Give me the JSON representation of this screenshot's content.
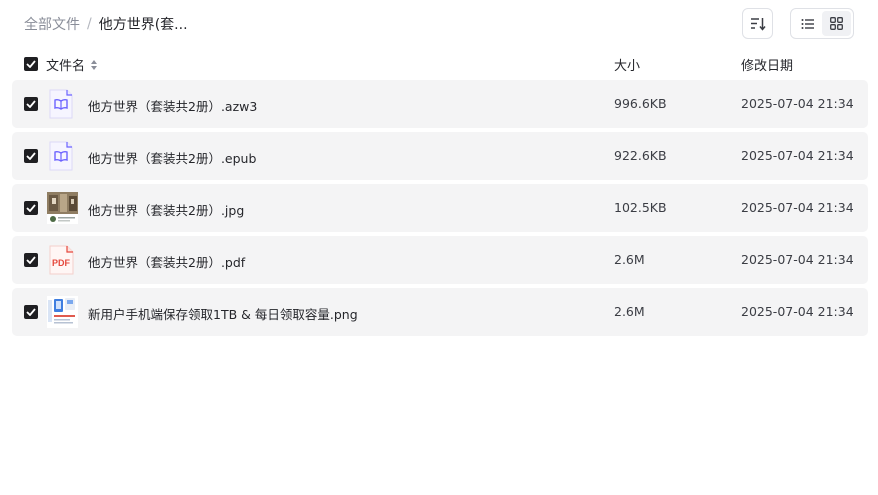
{
  "breadcrumb": {
    "root": "全部文件",
    "separator": "/",
    "current": "他方世界(套..."
  },
  "header": {
    "name": "文件名",
    "size": "大小",
    "modified": "修改日期"
  },
  "files": [
    {
      "name": "他方世界（套装共2册）.azw3",
      "size": "996.6KB",
      "modified": "2025-07-04 21:34",
      "icon": "book-icon"
    },
    {
      "name": "他方世界（套装共2册）.epub",
      "size": "922.6KB",
      "modified": "2025-07-04 21:34",
      "icon": "book-icon"
    },
    {
      "name": "他方世界（套装共2册）.jpg",
      "size": "102.5KB",
      "modified": "2025-07-04 21:34",
      "icon": "image-thumbnail"
    },
    {
      "name": "他方世界（套装共2册）.pdf",
      "size": "2.6M",
      "modified": "2025-07-04 21:34",
      "icon": "pdf-icon",
      "badge": "PDF"
    },
    {
      "name": "新用户手机端保存领取1TB & 每日领取容量.png",
      "size": "2.6M",
      "modified": "2025-07-04 21:34",
      "icon": "image-thumbnail"
    }
  ],
  "colors": {
    "accent": "#6c63ff",
    "pdf_red": "#e5483d",
    "row_bg": "#f4f4f5"
  }
}
